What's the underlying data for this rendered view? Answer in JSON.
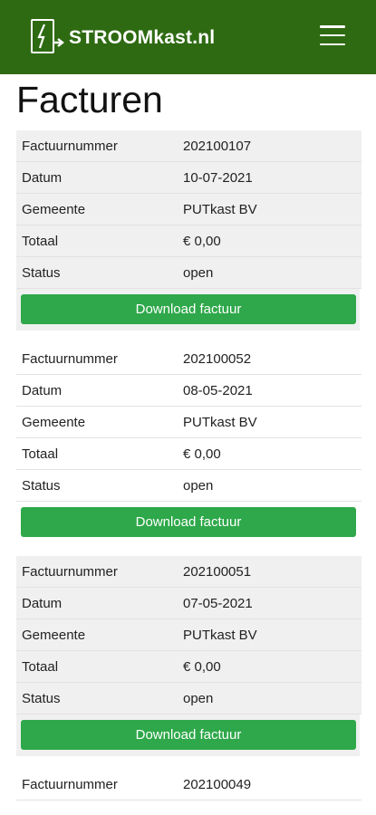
{
  "header": {
    "logo_text": "STROOMkast.nl",
    "brand_color": "#2e6a12"
  },
  "page": {
    "title": "Facturen"
  },
  "labels": {
    "number": "Factuurnummer",
    "date": "Datum",
    "municipality": "Gemeente",
    "total": "Totaal",
    "status": "Status",
    "download": "Download factuur"
  },
  "invoices": [
    {
      "number": "202100107",
      "date": "10-07-2021",
      "municipality": "PUTkast BV",
      "total": "€ 0,00",
      "status": "open"
    },
    {
      "number": "202100052",
      "date": "08-05-2021",
      "municipality": "PUTkast BV",
      "total": "€ 0,00",
      "status": "open"
    },
    {
      "number": "202100051",
      "date": "07-05-2021",
      "municipality": "PUTkast BV",
      "total": "€ 0,00",
      "status": "open"
    },
    {
      "number": "202100049"
    }
  ],
  "colors": {
    "button": "#2ea84a",
    "row_shade": "#f0f0f0"
  }
}
